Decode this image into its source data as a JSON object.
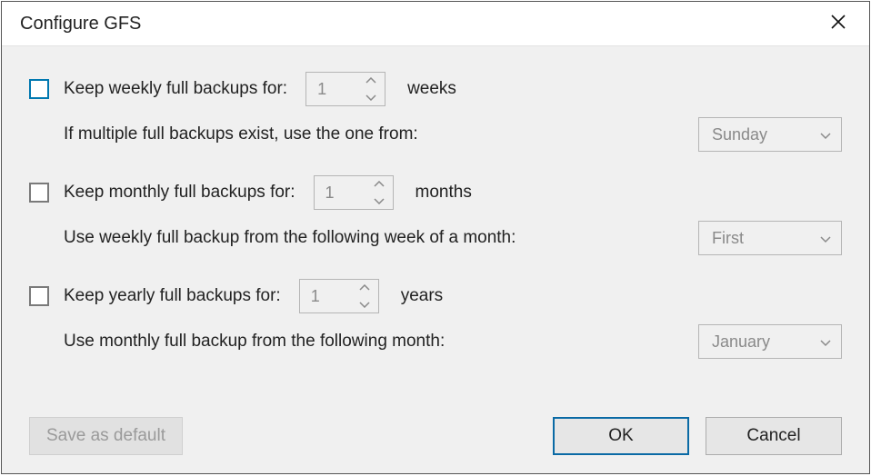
{
  "window": {
    "title": "Configure GFS"
  },
  "weekly": {
    "checkbox_label": "Keep weekly full backups for:",
    "spinner_value": "1",
    "unit": "weeks",
    "sub_label": "If multiple full backups exist, use the one from:",
    "select_value": "Sunday"
  },
  "monthly": {
    "checkbox_label": "Keep monthly full backups for:",
    "spinner_value": "1",
    "unit": "months",
    "sub_label": "Use weekly full backup from the following week of a month:",
    "select_value": "First"
  },
  "yearly": {
    "checkbox_label": "Keep yearly full backups for:",
    "spinner_value": "1",
    "unit": "years",
    "sub_label": "Use monthly full backup from the following month:",
    "select_value": "January"
  },
  "footer": {
    "save_default": "Save as default",
    "ok": "OK",
    "cancel": "Cancel"
  }
}
